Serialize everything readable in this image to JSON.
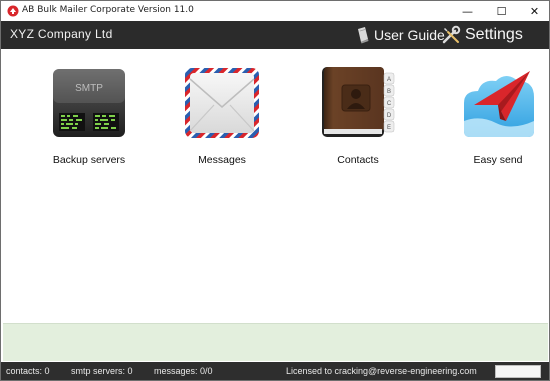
{
  "window": {
    "title": "AB Bulk Mailer Corporate Version 11.0",
    "controls": {
      "minimize": "—",
      "maximize": "☐",
      "close": "✕"
    }
  },
  "header": {
    "company": "XYZ Company Ltd",
    "user_guide": "User Guide",
    "settings": "Settings"
  },
  "tiles": [
    {
      "label": "Backup servers",
      "icon": "smtp-server-icon",
      "icon_text": "SMTP"
    },
    {
      "label": "Messages",
      "icon": "envelope-icon"
    },
    {
      "label": "Contacts",
      "icon": "address-book-icon",
      "tabs": [
        "A",
        "B",
        "C",
        "D",
        "E"
      ]
    },
    {
      "label": "Easy send",
      "icon": "paper-plane-icon"
    }
  ],
  "status": {
    "contacts": "contacts: 0",
    "smtp_servers": "smtp servers: 0",
    "messages": "messages: 0/0",
    "license": "Licensed to cracking@reverse-engineering.com"
  },
  "colors": {
    "header_bg": "#2b2b2b",
    "status_bg": "#2e2e2e",
    "panel_bg": "#e3efdd",
    "accent_red": "#d9262b"
  }
}
